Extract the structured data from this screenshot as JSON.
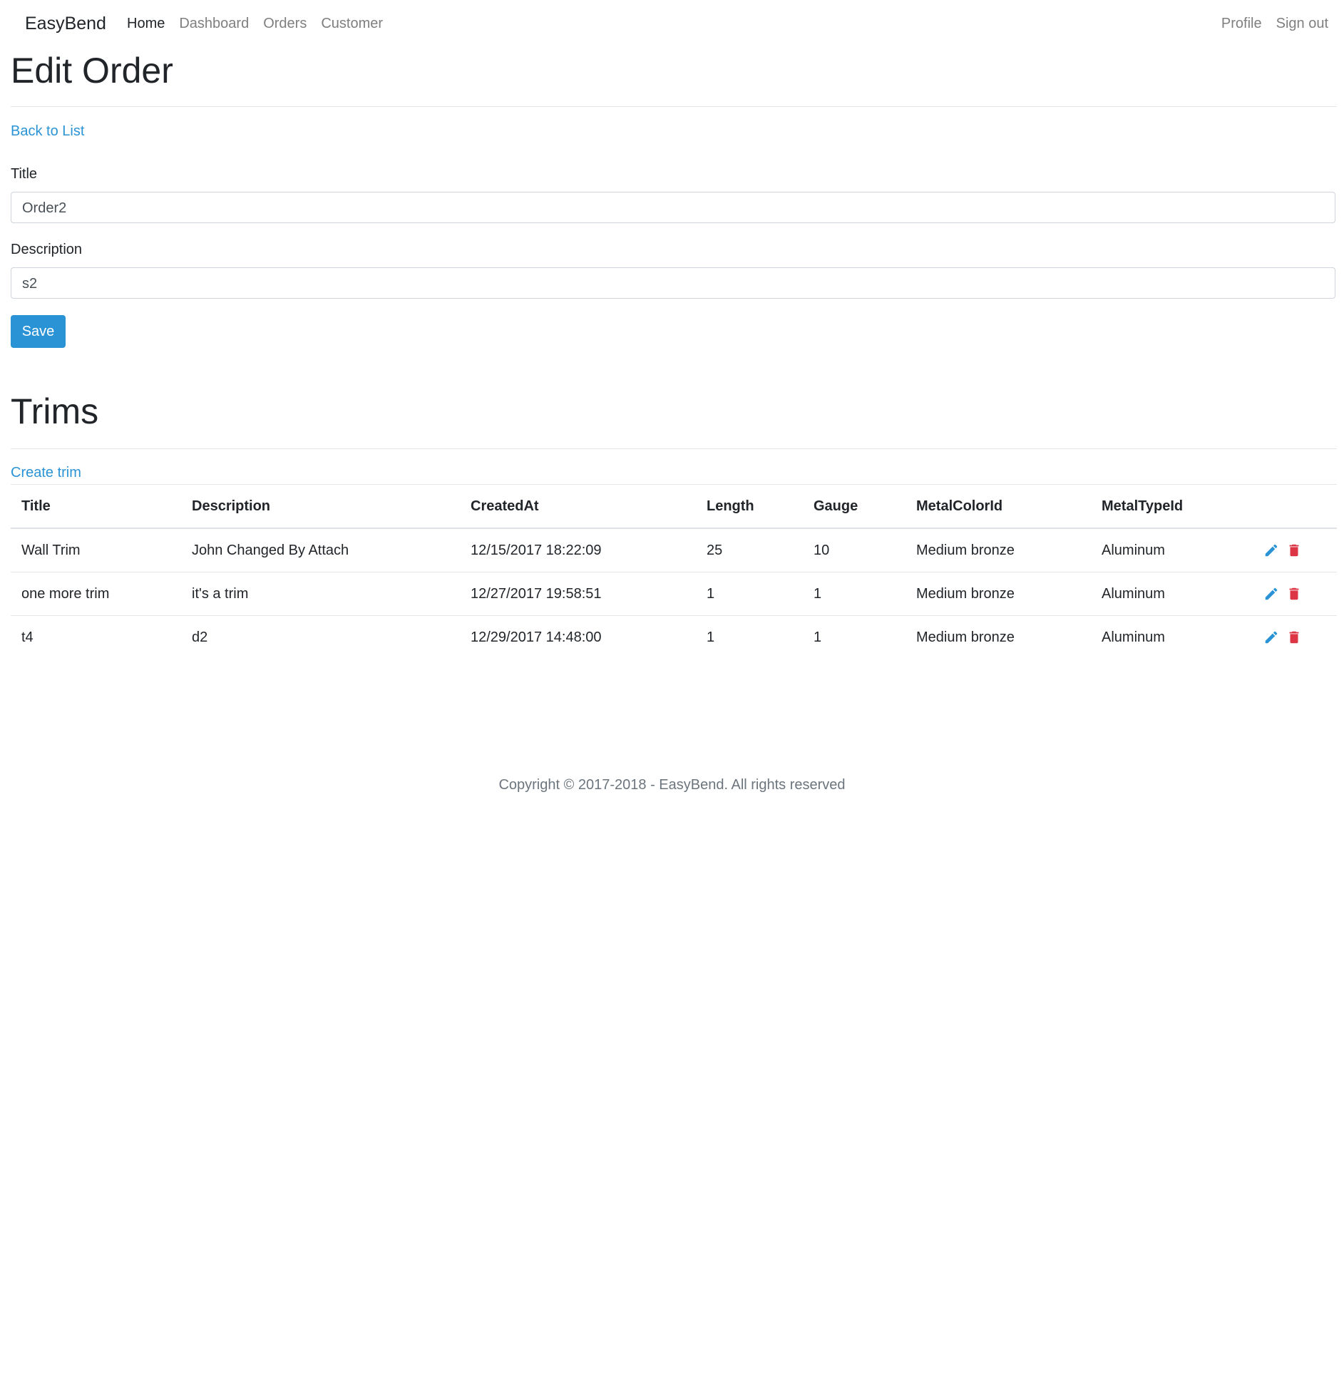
{
  "nav": {
    "brand": "EasyBend",
    "left": [
      {
        "label": "Home"
      },
      {
        "label": "Dashboard"
      },
      {
        "label": "Orders"
      },
      {
        "label": "Customer"
      }
    ],
    "right": [
      {
        "label": "Profile"
      },
      {
        "label": "Sign out"
      }
    ]
  },
  "edit": {
    "heading": "Edit Order",
    "back_link": "Back to List",
    "title_label": "Title",
    "title_value": "Order2",
    "description_label": "Description",
    "description_value": "s2",
    "save_label": "Save"
  },
  "trims": {
    "heading": "Trims",
    "create_link": "Create trim",
    "columns": [
      "Title",
      "Description",
      "CreatedAt",
      "Length",
      "Gauge",
      "MetalColorId",
      "MetalTypeId"
    ],
    "rows": [
      [
        "Wall Trim",
        "John Changed By Attach",
        "12/15/2017 18:22:09",
        "25",
        "10",
        "Medium bronze",
        "Aluminum"
      ],
      [
        "one more trim",
        "it's a trim",
        "12/27/2017 19:58:51",
        "1",
        "1",
        "Medium bronze",
        "Aluminum"
      ],
      [
        "t4",
        "d2",
        "12/29/2017 14:48:00",
        "1",
        "1",
        "Medium bronze",
        "Aluminum"
      ]
    ]
  },
  "footer": {
    "text": "Copyright © 2017-2018 - EasyBend. All rights reserved"
  },
  "colors": {
    "primary": "#2a93d5",
    "danger": "#dc3545"
  }
}
